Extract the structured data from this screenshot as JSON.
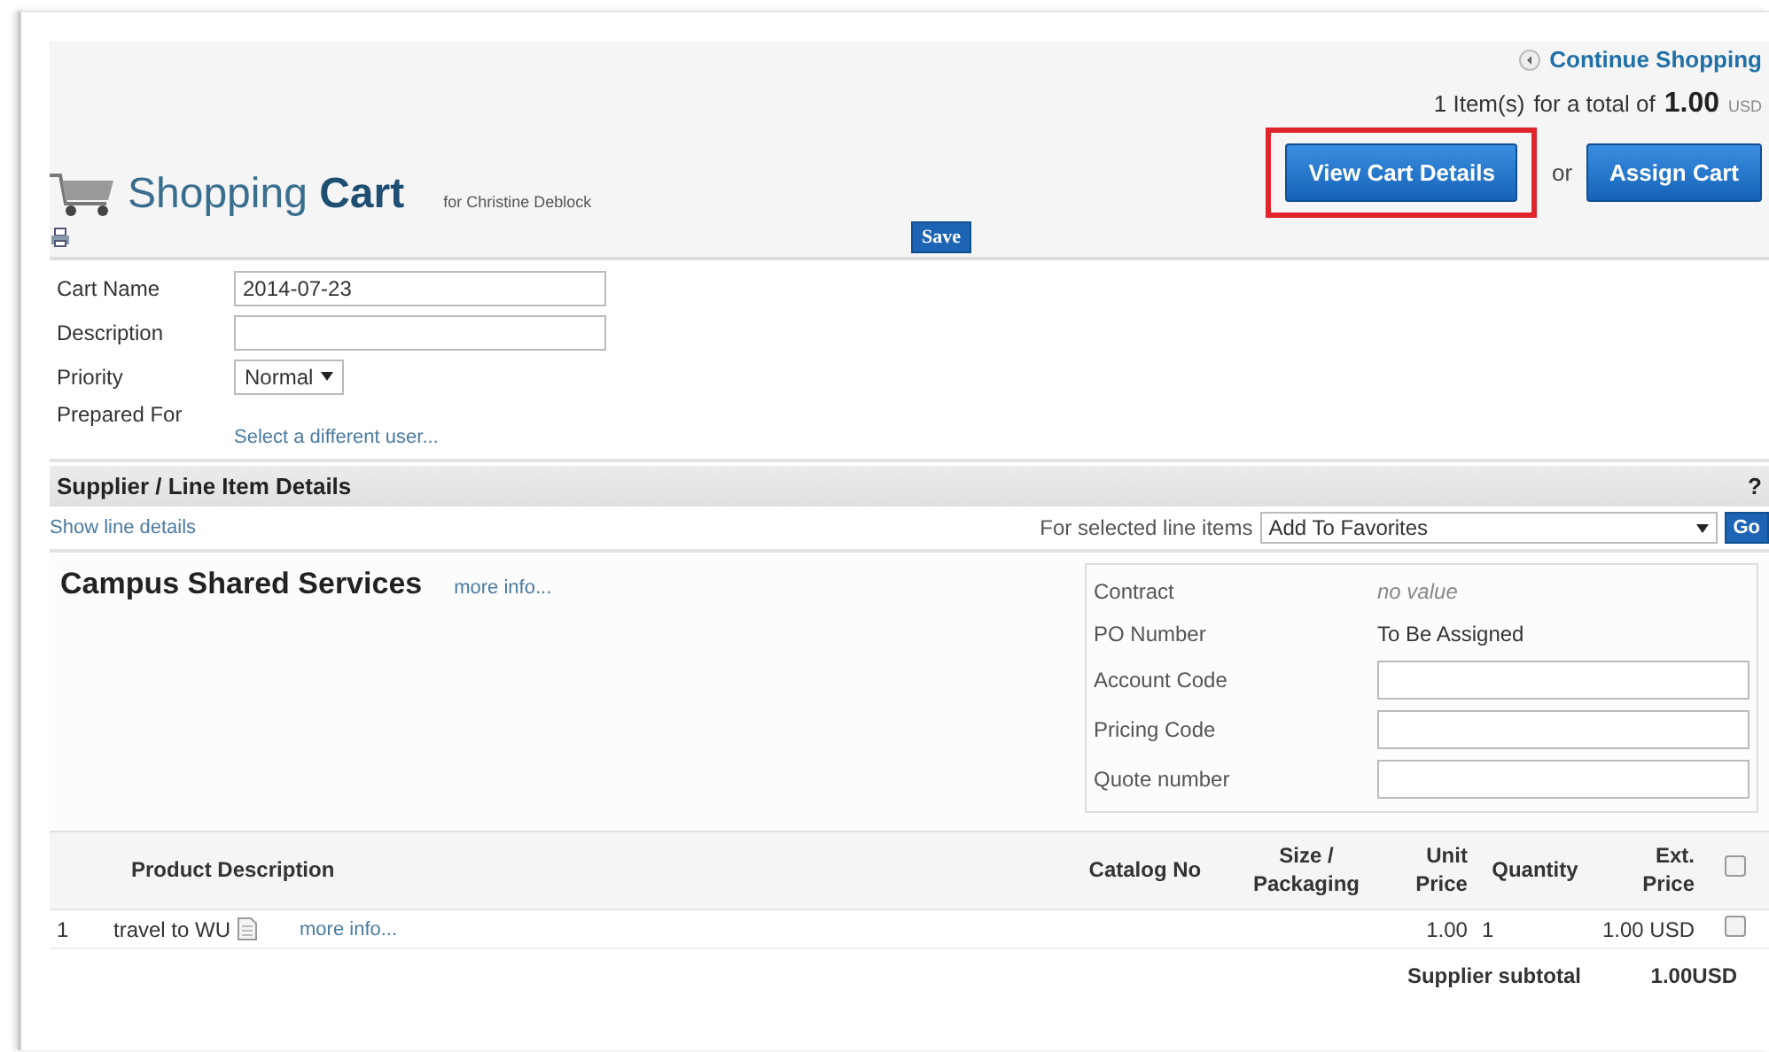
{
  "header": {
    "continue_link": "Continue Shopping",
    "summary": {
      "items": "1 Item(s)",
      "text": "for a total of",
      "amount": "1.00",
      "currency": "USD"
    },
    "title": {
      "word1": "Shopping",
      "word2": "Cart",
      "for_text": "for Christine Deblock"
    },
    "save_button": "Save",
    "view_button": "View Cart Details",
    "or_text": "or",
    "assign_button": "Assign Cart",
    "view_highlighted": true
  },
  "form": [
    {
      "label": "Cart Name",
      "kind": "text",
      "value": "2014-07-23"
    },
    {
      "label": "Description",
      "kind": "text"
    },
    {
      "label": "Priority",
      "kind": "select",
      "value": "Normal"
    },
    {
      "label": "Prepared For",
      "kind": "user",
      "link": "Select a different user..."
    }
  ],
  "section": {
    "title": "Supplier / Line Item Details",
    "help": "?",
    "show_link": "Show line details",
    "action_label": "For selected line items",
    "action_value": "Add To Favorites",
    "go_button": "Go"
  },
  "supplier": {
    "name": "Campus Shared Services",
    "more_info": "more info...",
    "details": [
      {
        "label": "Contract",
        "kind": "placeholder",
        "value": "no value"
      },
      {
        "label": "PO Number",
        "kind": "text",
        "value": "To Be Assigned"
      },
      {
        "label": "Account Code",
        "kind": "input"
      },
      {
        "label": "Pricing Code",
        "kind": "input"
      },
      {
        "label": "Quote number",
        "kind": "input"
      }
    ]
  },
  "table": {
    "columns": [
      "Product Description",
      "Catalog No",
      "Size / Packaging",
      "Unit Price",
      "Quantity",
      "Ext. Price"
    ],
    "header_checked": false,
    "rows": [
      {
        "number": "1",
        "description": "travel to WU",
        "more_info": "more info...",
        "unit_price": "1.00",
        "quantity": "1",
        "ext_price": "1.00 USD",
        "checked": false
      }
    ],
    "subtotal_label": "Supplier subtotal",
    "subtotal_value": "1.00USD"
  }
}
